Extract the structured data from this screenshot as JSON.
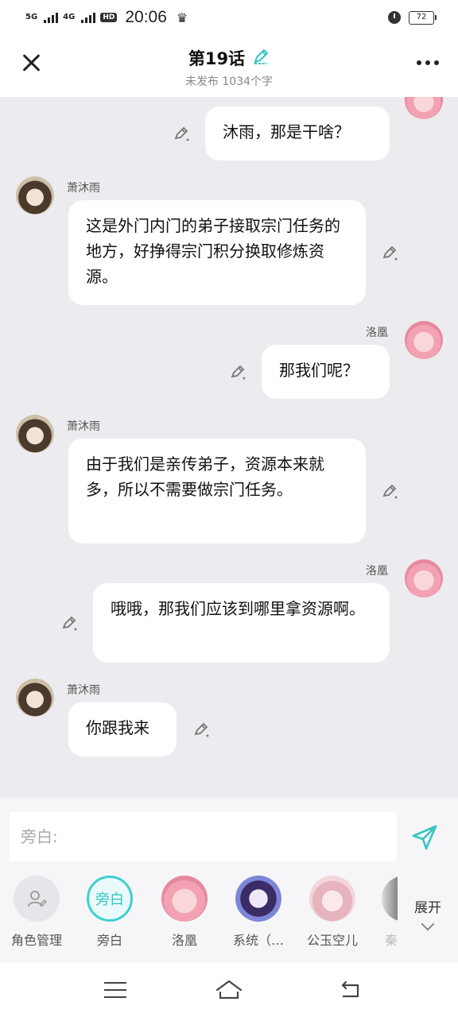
{
  "status_bar": {
    "network_1": "5G",
    "network_2": "4G",
    "hd": "HD",
    "time": "20:06",
    "battery": "72"
  },
  "header": {
    "title": "第19话",
    "subtitle": "未发布 1034个字"
  },
  "messages": [
    {
      "side": "right",
      "speaker": "",
      "avatar": "pink-avatar",
      "text": "沐雨，那是干啥？"
    },
    {
      "side": "left",
      "speaker": "萧沐雨",
      "avatar": "xiao-avatar",
      "text": "这是外门内门的弟子接取宗门任务的地方，好挣得宗门积分换取修炼资源。"
    },
    {
      "side": "right",
      "speaker": "洛凰",
      "avatar": "pink-avatar",
      "text": "那我们呢？"
    },
    {
      "side": "left",
      "speaker": "萧沐雨",
      "avatar": "xiao-avatar",
      "text": "由于我们是亲传弟子，资源本来就多，所以不需要做宗门任务。"
    },
    {
      "side": "right",
      "speaker": "洛凰",
      "avatar": "pink-avatar",
      "text": "哦哦，那我们应该到哪里拿资源啊。"
    },
    {
      "side": "left",
      "speaker": "萧沐雨",
      "avatar": "xiao-avatar",
      "text": "你跟我来"
    }
  ],
  "composer": {
    "placeholder": "旁白:"
  },
  "roles": {
    "manage_label": "角色管理",
    "narrator_badge": "旁白",
    "narrator_label": "旁白",
    "luohuang_label": "洛凰",
    "system_label": "系统（…",
    "gong_label": "公玉空儿",
    "partial_label": "秦",
    "expand_label": "展开"
  },
  "colors": {
    "accent": "#3fd0cf",
    "chat_bg": "#ececf0",
    "bubble": "#ffffff"
  }
}
